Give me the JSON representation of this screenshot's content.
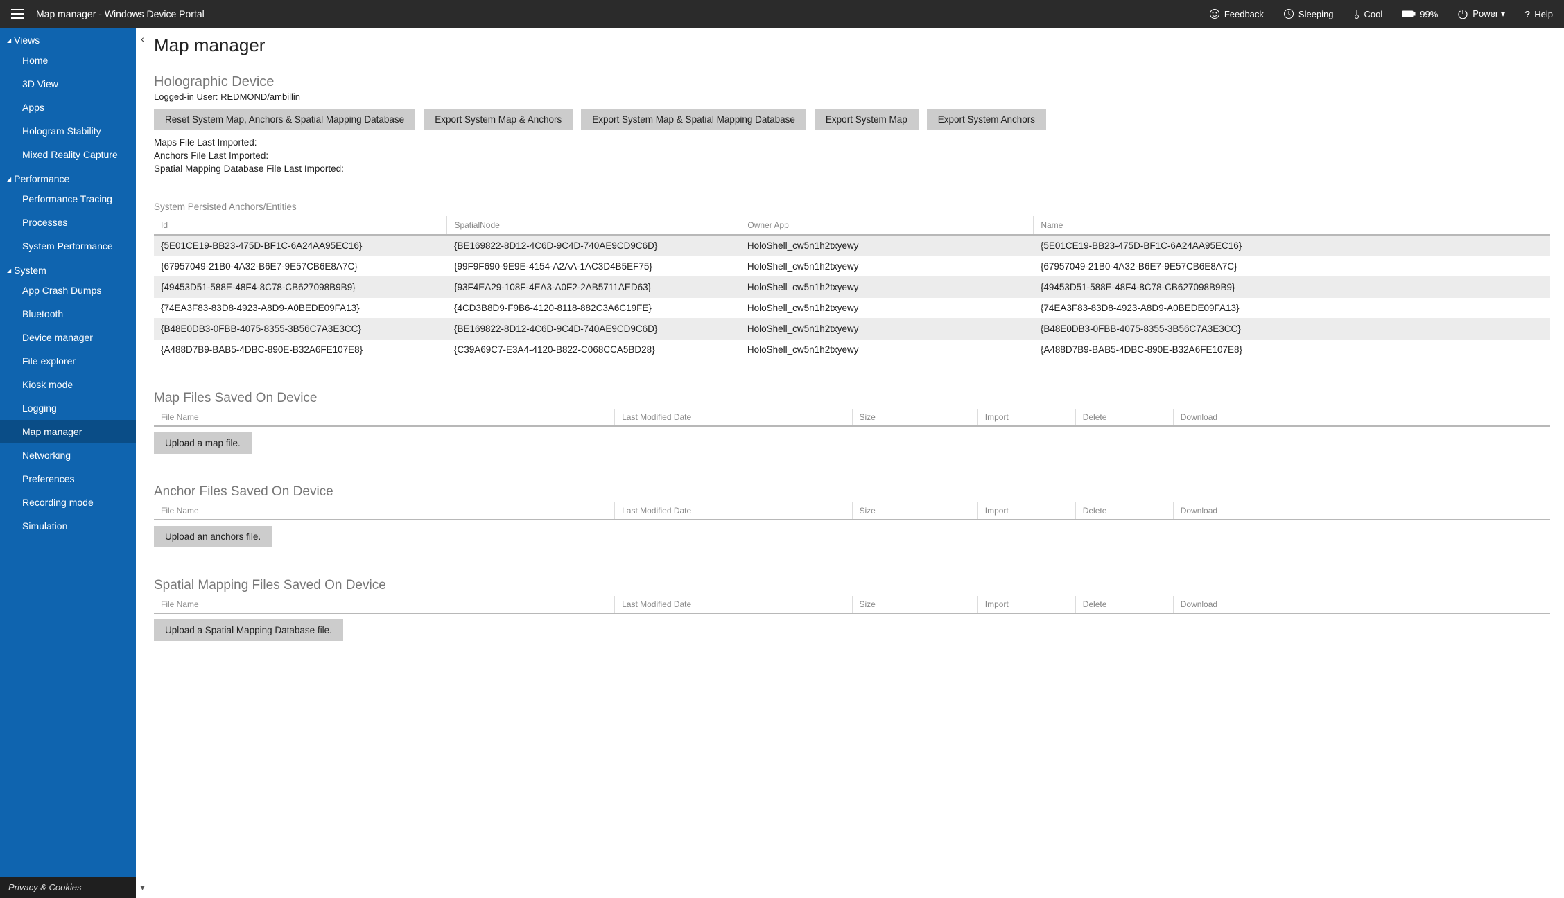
{
  "topbar": {
    "title": "Map manager - Windows Device Portal",
    "status": {
      "feedback": "Feedback",
      "sleeping": "Sleeping",
      "cool": "Cool",
      "battery": "99%",
      "power": "Power ▾",
      "help": "Help"
    }
  },
  "sidebar": {
    "groups": [
      {
        "label": "Views",
        "items": [
          "Home",
          "3D View",
          "Apps",
          "Hologram Stability",
          "Mixed Reality Capture"
        ]
      },
      {
        "label": "Performance",
        "items": [
          "Performance Tracing",
          "Processes",
          "System Performance"
        ]
      },
      {
        "label": "System",
        "items": [
          "App Crash Dumps",
          "Bluetooth",
          "Device manager",
          "File explorer",
          "Kiosk mode",
          "Logging",
          "Map manager",
          "Networking",
          "Preferences",
          "Recording mode",
          "Simulation"
        ]
      }
    ],
    "active": "Map manager",
    "footer": "Privacy & Cookies"
  },
  "page": {
    "title": "Map manager",
    "holo_section": "Holographic Device",
    "logged_in_label": "Logged-in User: ",
    "logged_in_user": "REDMOND/ambillin",
    "buttons": {
      "reset": "Reset System Map, Anchors & Spatial Mapping Database",
      "export_map_anchors": "Export System Map & Anchors",
      "export_map_spatial": "Export System Map & Spatial Mapping Database",
      "export_map": "Export System Map",
      "export_anchors": "Export System Anchors"
    },
    "info": {
      "maps_imported": "Maps File Last Imported:",
      "anchors_imported": "Anchors File Last Imported:",
      "spatial_imported": "Spatial Mapping Database File Last Imported:"
    },
    "anchors_table": {
      "heading": "System Persisted Anchors/Entities",
      "cols": [
        "Id",
        "SpatialNode",
        "Owner App",
        "Name"
      ],
      "rows": [
        [
          "{5E01CE19-BB23-475D-BF1C-6A24AA95EC16}",
          "{BE169822-8D12-4C6D-9C4D-740AE9CD9C6D}",
          "HoloShell_cw5n1h2txyewy",
          "{5E01CE19-BB23-475D-BF1C-6A24AA95EC16}"
        ],
        [
          "{67957049-21B0-4A32-B6E7-9E57CB6E8A7C}",
          "{99F9F690-9E9E-4154-A2AA-1AC3D4B5EF75}",
          "HoloShell_cw5n1h2txyewy",
          "{67957049-21B0-4A32-B6E7-9E57CB6E8A7C}"
        ],
        [
          "{49453D51-588E-48F4-8C78-CB627098B9B9}",
          "{93F4EA29-108F-4EA3-A0F2-2AB5711AED63}",
          "HoloShell_cw5n1h2txyewy",
          "{49453D51-588E-48F4-8C78-CB627098B9B9}"
        ],
        [
          "{74EA3F83-83D8-4923-A8D9-A0BEDE09FA13}",
          "{4CD3B8D9-F9B6-4120-8118-882C3A6C19FE}",
          "HoloShell_cw5n1h2txyewy",
          "{74EA3F83-83D8-4923-A8D9-A0BEDE09FA13}"
        ],
        [
          "{B48E0DB3-0FBB-4075-8355-3B56C7A3E3CC}",
          "{BE169822-8D12-4C6D-9C4D-740AE9CD9C6D}",
          "HoloShell_cw5n1h2txyewy",
          "{B48E0DB3-0FBB-4075-8355-3B56C7A3E3CC}"
        ],
        [
          "{A488D7B9-BAB5-4DBC-890E-B32A6FE107E8}",
          "{C39A69C7-E3A4-4120-B822-C068CCA5BD28}",
          "HoloShell_cw5n1h2txyewy",
          "{A488D7B9-BAB5-4DBC-890E-B32A6FE107E8}"
        ]
      ]
    },
    "file_sections": [
      {
        "title": "Map Files Saved On Device",
        "upload": "Upload a map file."
      },
      {
        "title": "Anchor Files Saved On Device",
        "upload": "Upload an anchors file."
      },
      {
        "title": "Spatial Mapping Files Saved On Device",
        "upload": "Upload a Spatial Mapping Database file."
      }
    ],
    "file_cols": [
      "File Name",
      "Last Modified Date",
      "Size",
      "Import",
      "Delete",
      "Download"
    ]
  }
}
